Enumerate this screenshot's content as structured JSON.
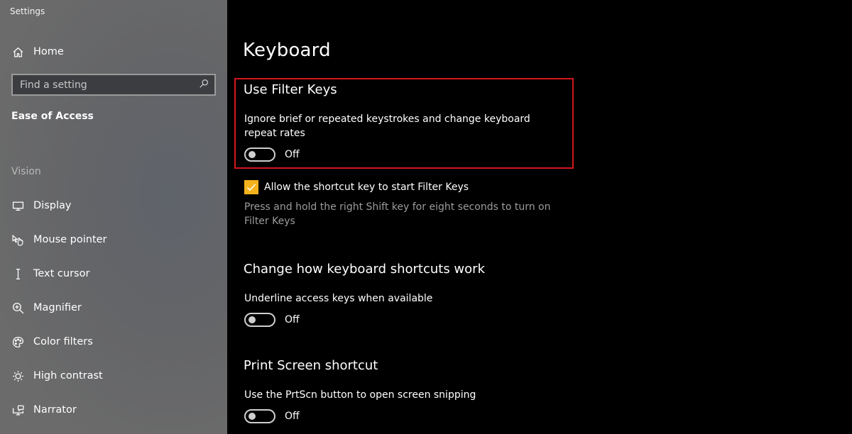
{
  "window": {
    "title": "Settings"
  },
  "sidebar": {
    "home": {
      "label": "Home",
      "icon": "home-icon"
    },
    "search": {
      "placeholder": "Find a setting",
      "value": "",
      "icon": "search-icon"
    },
    "current_section": "Ease of Access",
    "group_label": "Vision",
    "items": [
      {
        "label": "Display",
        "icon": "display-icon"
      },
      {
        "label": "Mouse pointer",
        "icon": "mouse-pointer-icon"
      },
      {
        "label": "Text cursor",
        "icon": "text-cursor-icon"
      },
      {
        "label": "Magnifier",
        "icon": "magnifier-icon"
      },
      {
        "label": "Color filters",
        "icon": "color-filters-icon"
      },
      {
        "label": "High contrast",
        "icon": "high-contrast-icon"
      },
      {
        "label": "Narrator",
        "icon": "narrator-icon"
      }
    ]
  },
  "main": {
    "title": "Keyboard",
    "filter_keys": {
      "heading": "Use Filter Keys",
      "description": "Ignore brief or repeated keystrokes and change keyboard repeat rates",
      "toggle_on": false,
      "toggle_state": "Off",
      "shortcut_checkbox": {
        "checked": true,
        "label": "Allow the shortcut key to start Filter Keys",
        "help": "Press and hold the right Shift key for eight seconds to turn on Filter Keys"
      }
    },
    "shortcuts": {
      "heading": "Change how keyboard shortcuts work",
      "description": "Underline access keys when available",
      "toggle_on": false,
      "toggle_state": "Off"
    },
    "print_screen": {
      "heading": "Print Screen shortcut",
      "description": "Use the PrtScn button to open screen snipping",
      "toggle_on": false,
      "toggle_state": "Off"
    }
  },
  "colors": {
    "highlight_border": "#d5161c",
    "checkbox_accent": "#f4b21d",
    "main_background": "#000000",
    "sidebar_background": "#676767"
  }
}
